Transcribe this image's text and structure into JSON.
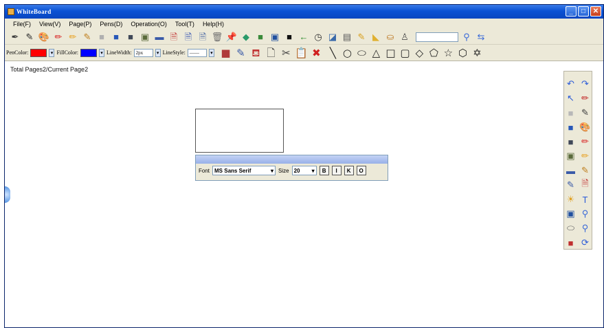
{
  "window": {
    "title": "WhiteBoard"
  },
  "menu": [
    "File(F)",
    "View(V)",
    "Page(P)",
    "Pens(D)",
    "Operation(O)",
    "Tool(T)",
    "Help(H)"
  ],
  "toolbar1": {
    "icons": [
      {
        "name": "pen-icon",
        "glyph": "✒",
        "color": "#3c3c3c"
      },
      {
        "name": "brush-icon",
        "glyph": "✎",
        "color": "#2a2a2a"
      },
      {
        "name": "palette-icon",
        "glyph": "🎨",
        "color": "#d65c1a"
      },
      {
        "name": "red-marker-icon",
        "glyph": "✏",
        "color": "#d82020"
      },
      {
        "name": "yellow-marker-icon",
        "glyph": "✏",
        "color": "#e8a020"
      },
      {
        "name": "highlighter-icon",
        "glyph": "✎",
        "color": "#c08020"
      },
      {
        "name": "gray-box-icon",
        "glyph": "■",
        "color": "#b0b0b0"
      },
      {
        "name": "blue-monitor-icon",
        "glyph": "■",
        "color": "#2858b8"
      },
      {
        "name": "dark-monitor-icon",
        "glyph": "■",
        "color": "#404858"
      },
      {
        "name": "photo-icon",
        "glyph": "▣",
        "color": "#5a6a3a"
      },
      {
        "name": "landscape-icon",
        "glyph": "▬",
        "color": "#3a5aa8"
      },
      {
        "name": "page-red-icon",
        "glyph": "🗎",
        "color": "#c03030"
      },
      {
        "name": "page-blue-icon",
        "glyph": "🗎",
        "color": "#3050b0"
      },
      {
        "name": "page-icon",
        "glyph": "🗎",
        "color": "#4060a0"
      },
      {
        "name": "trash-icon",
        "glyph": "🗑",
        "color": "#707070"
      },
      {
        "name": "pin-icon",
        "glyph": "📌",
        "color": "#c02020"
      },
      {
        "name": "eraser-icon",
        "glyph": "◆",
        "color": "#2a9a6a"
      },
      {
        "name": "save-icon",
        "glyph": "■",
        "color": "#3a8a3a"
      },
      {
        "name": "screen-icon",
        "glyph": "▣",
        "color": "#2050a0"
      },
      {
        "name": "black-square-icon",
        "glyph": "■",
        "color": "#101010"
      },
      {
        "name": "arrow-left-icon",
        "glyph": "←",
        "color": "#2a8a2a"
      },
      {
        "name": "clock-icon",
        "glyph": "◷",
        "color": "#333333"
      },
      {
        "name": "chart-icon",
        "glyph": "◪",
        "color": "#3a6aaa"
      },
      {
        "name": "window-icon",
        "glyph": "▤",
        "color": "#5a5a5a"
      },
      {
        "name": "pencil-yellow-icon",
        "glyph": "✎",
        "color": "#d8a020"
      },
      {
        "name": "select-icon",
        "glyph": "◣",
        "color": "#e0b030"
      },
      {
        "name": "bucket-icon",
        "glyph": "⛀",
        "color": "#c08030"
      },
      {
        "name": "figure-icon",
        "glyph": "♙",
        "color": "#505050"
      }
    ],
    "search_placeholder": "",
    "tail_icons": [
      {
        "name": "magnifier-icon",
        "glyph": "⚲",
        "color": "#3a6ad8"
      },
      {
        "name": "swap-icon",
        "glyph": "⇆",
        "color": "#3a6ad8"
      }
    ]
  },
  "toolbar2": {
    "pen_color_label": "PenColor:",
    "pen_color": "#ff0000",
    "fill_color_label": "FillColor:",
    "fill_color": "#0000ff",
    "line_width_label": "LineWidth:",
    "line_width_value": "2px",
    "line_style_label": "LineStyle:",
    "line_style_value": "——",
    "tool_icons": [
      {
        "name": "stamp-icon",
        "glyph": "■",
        "color": "#b03a3a"
      },
      {
        "name": "edit-page-icon",
        "glyph": "✎",
        "color": "#3a5aa8"
      },
      {
        "name": "fill-icon",
        "glyph": "⛾",
        "color": "#c03030"
      },
      {
        "name": "copy-icon",
        "glyph": "🗋",
        "color": "#404040"
      },
      {
        "name": "cut-icon",
        "glyph": "✂",
        "color": "#404040"
      },
      {
        "name": "paste-icon",
        "glyph": "📋",
        "color": "#a06a2a"
      },
      {
        "name": "delete-icon",
        "glyph": "✖",
        "color": "#d02020"
      }
    ],
    "shape_icons": [
      {
        "name": "line-icon",
        "glyph": "╲"
      },
      {
        "name": "circle-icon",
        "glyph": "○"
      },
      {
        "name": "ellipse-icon",
        "glyph": "⬭"
      },
      {
        "name": "triangle-icon",
        "glyph": "△"
      },
      {
        "name": "square-icon",
        "glyph": "□"
      },
      {
        "name": "rounded-rect-icon",
        "glyph": "▢"
      },
      {
        "name": "diamond-icon",
        "glyph": "◇"
      },
      {
        "name": "pentagon-icon",
        "glyph": "⬠"
      },
      {
        "name": "star-icon",
        "glyph": "☆"
      },
      {
        "name": "hexagon-icon",
        "glyph": "⬡"
      },
      {
        "name": "six-star-icon",
        "glyph": "✡"
      }
    ]
  },
  "page_info": "Total Pages2/Current Page2",
  "font_panel": {
    "font_label": "Font",
    "font_value": "MS Sans Serif",
    "size_label": "Size",
    "size_value": "20",
    "bold": "B",
    "italic": "I",
    "underline": "K",
    "strike": "O"
  },
  "right_toolbar": [
    {
      "name": "undo-icon",
      "glyph": "↶",
      "color": "#2a5ad8"
    },
    {
      "name": "redo-icon",
      "glyph": "↷",
      "color": "#2a5ad8"
    },
    {
      "name": "pointer-icon",
      "glyph": "↖",
      "color": "#2a5ad8"
    },
    {
      "name": "pen-red-icon",
      "glyph": "✏",
      "color": "#c02020"
    },
    {
      "name": "gray-rect-icon",
      "glyph": "■",
      "color": "#b8b8b8"
    },
    {
      "name": "brush-icon",
      "glyph": "✎",
      "color": "#404040"
    },
    {
      "name": "blue-rect-icon",
      "glyph": "■",
      "color": "#2858b8"
    },
    {
      "name": "palette-icon",
      "glyph": "🎨",
      "color": "#d65c1a"
    },
    {
      "name": "dark-rect-icon",
      "glyph": "■",
      "color": "#404858"
    },
    {
      "name": "red-pen-icon",
      "glyph": "✏",
      "color": "#d82020"
    },
    {
      "name": "photo-icon",
      "glyph": "▣",
      "color": "#5a6a3a"
    },
    {
      "name": "yellow-pen-icon",
      "glyph": "✏",
      "color": "#e8a020"
    },
    {
      "name": "landscape-icon",
      "glyph": "▬",
      "color": "#3a5aa8"
    },
    {
      "name": "marker-icon",
      "glyph": "✎",
      "color": "#c08020"
    },
    {
      "name": "edit-page-icon",
      "glyph": "✎",
      "color": "#3a5aa8"
    },
    {
      "name": "page-red-icon",
      "glyph": "🗎",
      "color": "#c03030"
    },
    {
      "name": "sun-icon",
      "glyph": "☀",
      "color": "#e0a020"
    },
    {
      "name": "text-icon",
      "glyph": "T",
      "color": "#2a5ad8"
    },
    {
      "name": "screen-icon",
      "glyph": "▣",
      "color": "#2050a0"
    },
    {
      "name": "zoom-in-icon",
      "glyph": "⚲",
      "color": "#3a6ad8"
    },
    {
      "name": "eraser-icon",
      "glyph": "⬭",
      "color": "#606060"
    },
    {
      "name": "zoom-out-icon",
      "glyph": "⚲",
      "color": "#3a6ad8"
    },
    {
      "name": "layers-icon",
      "glyph": "■",
      "color": "#c03030"
    },
    {
      "name": "refresh-icon",
      "glyph": "⟳",
      "color": "#2a5ad8"
    }
  ]
}
